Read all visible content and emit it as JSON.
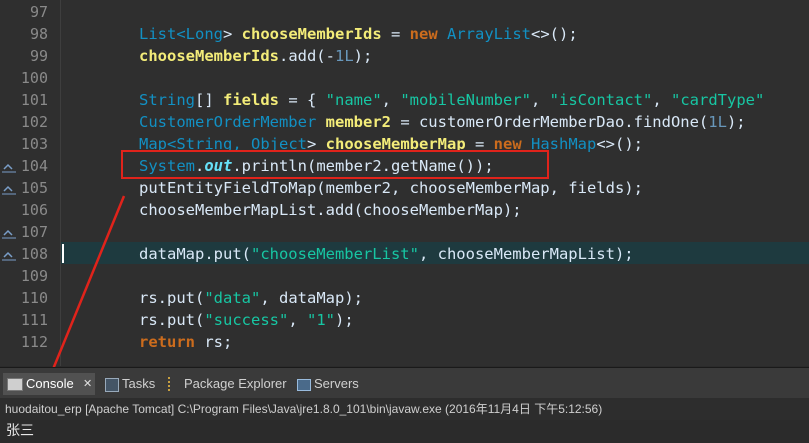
{
  "editor": {
    "line_numbers": [
      "97",
      "98",
      "99",
      "100",
      "101",
      "102",
      "103",
      "104",
      "105",
      "106",
      "107",
      "108",
      "109",
      "110",
      "111",
      "112"
    ],
    "lines": [
      [],
      [
        {
          "t": "List<",
          "c": "ty"
        },
        {
          "t": "Long",
          "c": "ty"
        },
        {
          "t": "> ",
          "c": ""
        },
        {
          "t": "chooseMemberIds",
          "c": "var"
        },
        {
          "t": " = ",
          "c": ""
        },
        {
          "t": "new",
          "c": "kw"
        },
        {
          "t": " ",
          "c": ""
        },
        {
          "t": "ArrayList",
          "c": "ty"
        },
        {
          "t": "<>();",
          "c": ""
        }
      ],
      [
        {
          "t": "chooseMemberIds",
          "c": "var"
        },
        {
          "t": ".add(-",
          "c": ""
        },
        {
          "t": "1L",
          "c": "num"
        },
        {
          "t": ");",
          "c": ""
        }
      ],
      [],
      [
        {
          "t": "String",
          "c": "ty"
        },
        {
          "t": "[] ",
          "c": ""
        },
        {
          "t": "fields",
          "c": "var"
        },
        {
          "t": " = { ",
          "c": ""
        },
        {
          "t": "\"name\"",
          "c": "st"
        },
        {
          "t": ", ",
          "c": ""
        },
        {
          "t": "\"mobileNumber\"",
          "c": "st"
        },
        {
          "t": ", ",
          "c": ""
        },
        {
          "t": "\"isContact\"",
          "c": "st"
        },
        {
          "t": ", ",
          "c": ""
        },
        {
          "t": "\"cardType\"",
          "c": "st"
        }
      ],
      [
        {
          "t": "CustomerOrderMember",
          "c": "ty"
        },
        {
          "t": " ",
          "c": ""
        },
        {
          "t": "member2",
          "c": "var"
        },
        {
          "t": " = customerOrderMemberDao.findOne(",
          "c": ""
        },
        {
          "t": "1L",
          "c": "num"
        },
        {
          "t": ");",
          "c": ""
        }
      ],
      [
        {
          "t": "Map<",
          "c": "tyu"
        },
        {
          "t": "String",
          "c": "tyu"
        },
        {
          "t": ", ",
          "c": "tyu"
        },
        {
          "t": "Object",
          "c": "tyu"
        },
        {
          "t": "> ",
          "c": ""
        },
        {
          "t": "chooseMemberMap",
          "c": "varu"
        },
        {
          "t": " = ",
          "c": ""
        },
        {
          "t": "new",
          "c": "kw"
        },
        {
          "t": " ",
          "c": ""
        },
        {
          "t": "HashMap",
          "c": "ty"
        },
        {
          "t": "<>();",
          "c": ""
        }
      ],
      [
        {
          "t": "System",
          "c": "ty"
        },
        {
          "t": ".",
          "c": ""
        },
        {
          "t": "out",
          "c": "fld"
        },
        {
          "t": ".println(",
          "c": ""
        },
        {
          "t": "member2",
          "c": ""
        },
        {
          "t": ".getName());",
          "c": ""
        }
      ],
      [
        {
          "t": "putEntityFieldToMap(",
          "c": ""
        },
        {
          "t": "member2",
          "c": ""
        },
        {
          "t": ", ",
          "c": ""
        },
        {
          "t": "chooseMemberMap",
          "c": ""
        },
        {
          "t": ", ",
          "c": ""
        },
        {
          "t": "fields",
          "c": ""
        },
        {
          "t": ");",
          "c": ""
        }
      ],
      [
        {
          "t": "chooseMemberMapList.add(",
          "c": ""
        },
        {
          "t": "chooseMemberMap",
          "c": ""
        },
        {
          "t": ");",
          "c": ""
        }
      ],
      [],
      [
        {
          "t": "dataMap.put(",
          "c": ""
        },
        {
          "t": "\"chooseMemberList\"",
          "c": "st"
        },
        {
          "t": ", ",
          "c": ""
        },
        {
          "t": "chooseMemberMapList",
          "c": ""
        },
        {
          "t": ");",
          "c": ""
        }
      ],
      [],
      [
        {
          "t": "rs.put(",
          "c": ""
        },
        {
          "t": "\"data\"",
          "c": "st"
        },
        {
          "t": ", dataMap);",
          "c": ""
        }
      ],
      [
        {
          "t": "rs.put(",
          "c": ""
        },
        {
          "t": "\"success\"",
          "c": "st"
        },
        {
          "t": ", ",
          "c": ""
        },
        {
          "t": "\"1\"",
          "c": "st"
        },
        {
          "t": ");",
          "c": ""
        }
      ],
      [
        {
          "t": "return",
          "c": "kw"
        },
        {
          "t": " rs;",
          "c": ""
        }
      ]
    ]
  },
  "tabs": [
    {
      "label": "Console",
      "icon": "console-icon",
      "active": true,
      "close": "✕"
    },
    {
      "label": "Tasks",
      "icon": "tasks-icon",
      "active": false
    },
    {
      "label": "Package Explorer",
      "icon": "package-explorer-icon",
      "active": false
    },
    {
      "label": "Servers",
      "icon": "servers-icon",
      "active": false
    }
  ],
  "console": {
    "title": "huodaitou_erp [Apache Tomcat] C:\\Program Files\\Java\\jre1.8.0_101\\bin\\javaw.exe (2016年11月4日 下午5:12:56)",
    "output": "张三"
  },
  "colors": {
    "annotation_red": "#e0231b",
    "editor_bg": "#2f2f2f"
  }
}
